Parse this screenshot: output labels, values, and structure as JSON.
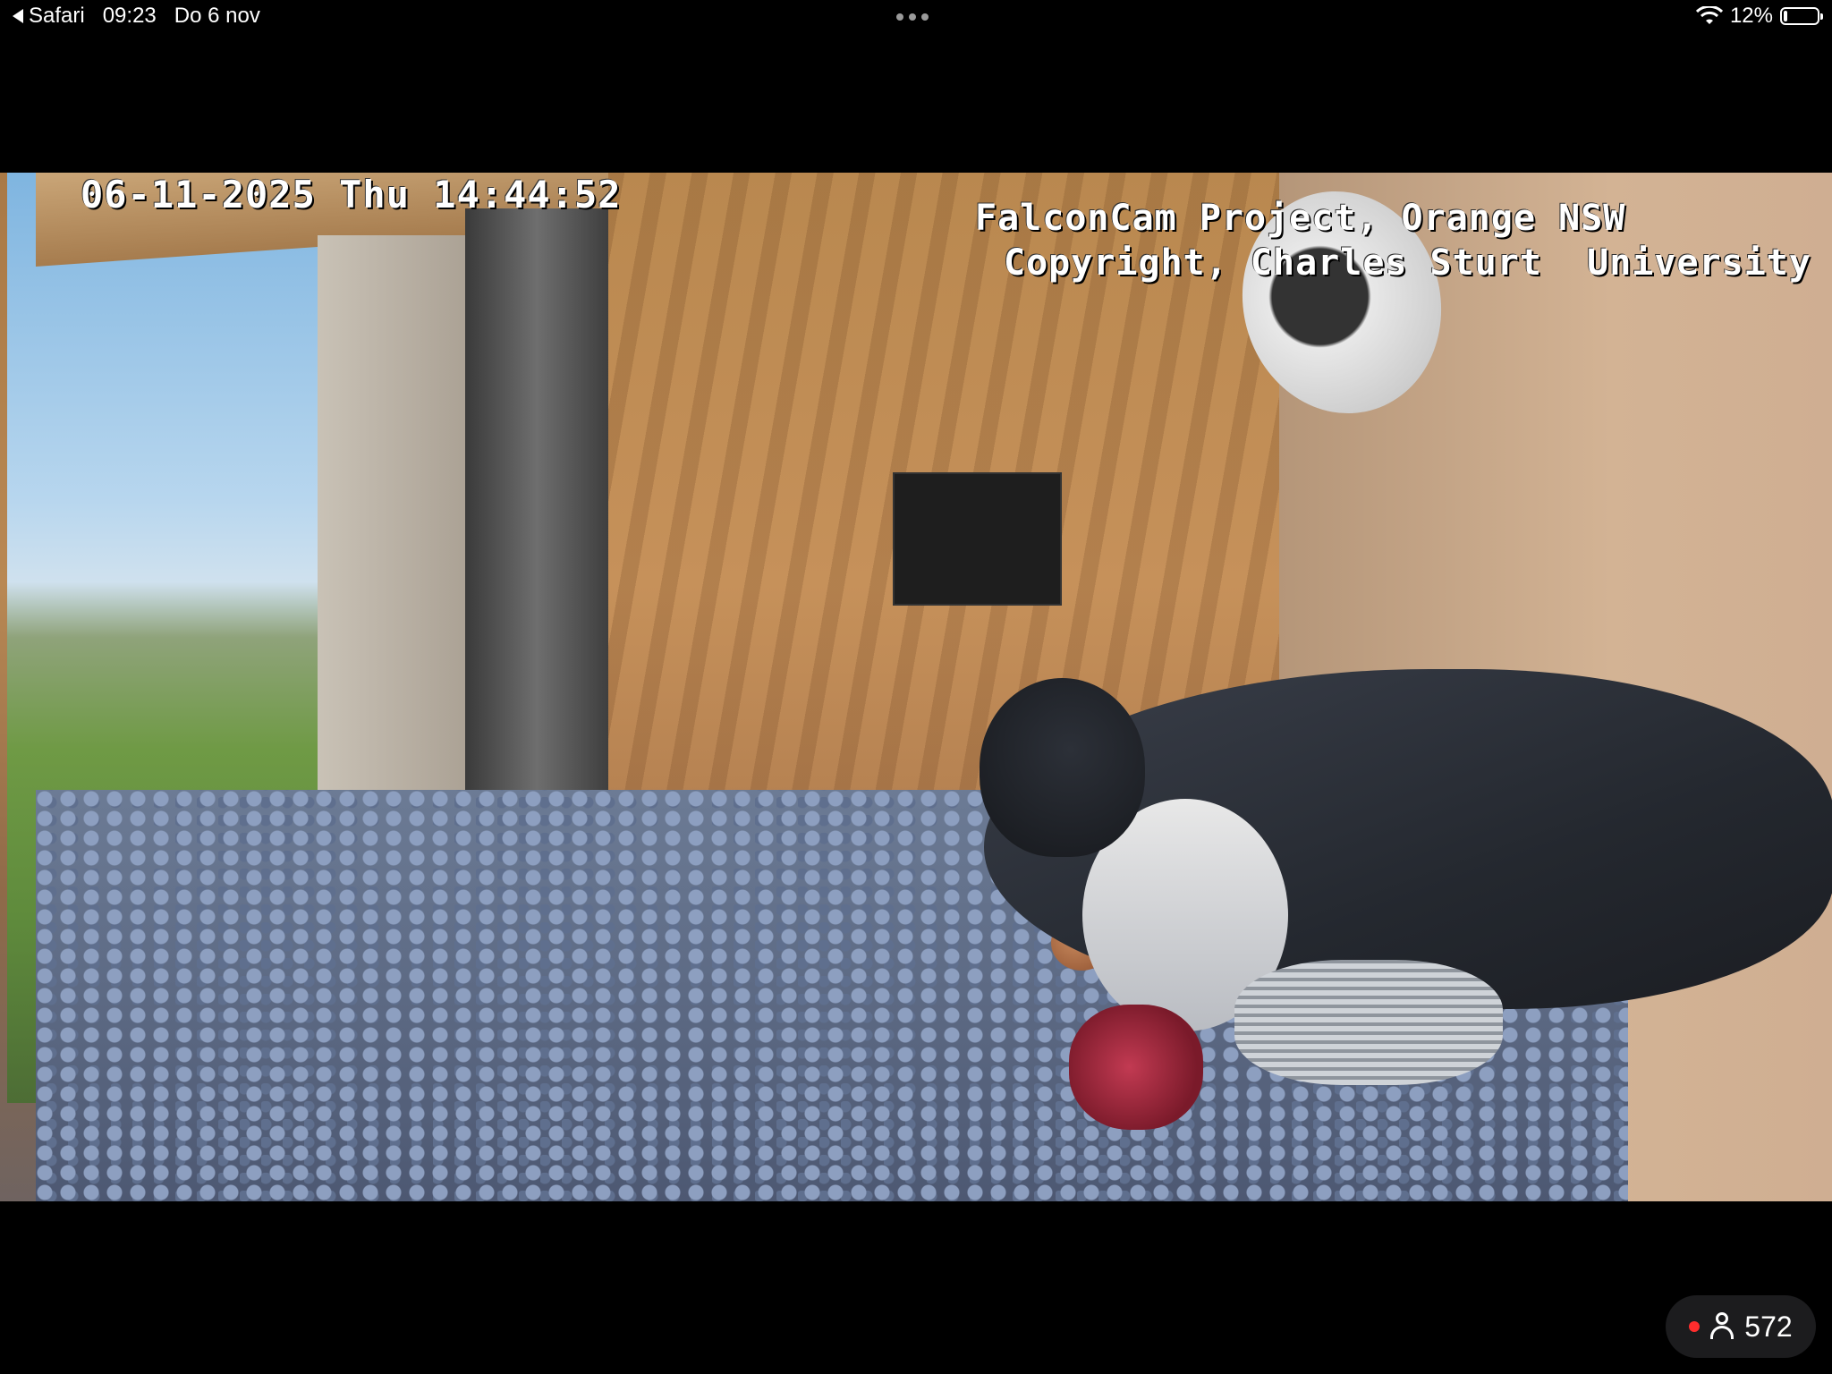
{
  "status_bar": {
    "back_app": "Safari",
    "time": "09:23",
    "date": "Do 6 nov",
    "battery": "12%",
    "icons": [
      "back-arrow-icon",
      "more-dots-icon",
      "wifi-icon",
      "battery-icon"
    ]
  },
  "video": {
    "timestamp": "06-11-2025 Thu 14:44:52",
    "credit_line_1": "FalconCam Project, Orange NSW",
    "credit_line_2": "Copyright, Charles Sturt  University"
  },
  "viewers": {
    "count": "572",
    "live_color": "#ff2d2d",
    "icon": "person-icon"
  }
}
